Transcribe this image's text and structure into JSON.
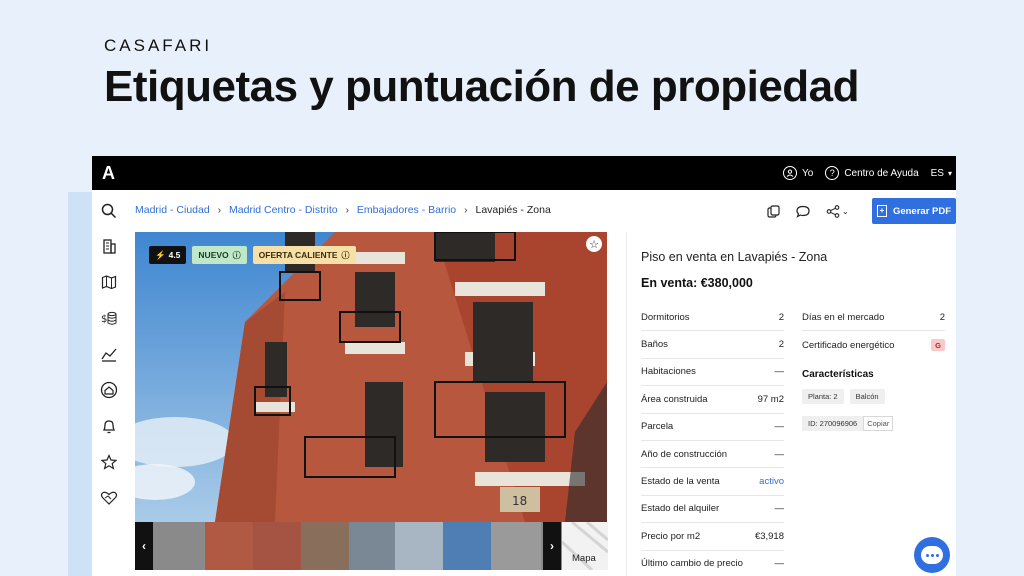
{
  "brand": "CASAFARI",
  "headline": "Etiquetas y puntuación de propiedad",
  "topbar": {
    "logo": "A",
    "user_label": "Yo",
    "help_label": "Centro de Ayuda",
    "language": "ES"
  },
  "breadcrumbs": [
    {
      "label": "Madrid - Ciudad"
    },
    {
      "label": "Madrid Centro - Distrito"
    },
    {
      "label": "Embajadores - Barrio"
    },
    {
      "label": "Lavapiés - Zona"
    }
  ],
  "toolbar": {
    "pdf_label": "Generar PDF"
  },
  "photo": {
    "score": "4.5",
    "new_tag": "NUEVO",
    "hot_tag": "OFERTA CALIENTE",
    "map_label": "Mapa",
    "door_number": "18"
  },
  "listing": {
    "title": "Piso en venta en Lavapiés - Zona",
    "price": "En venta: €380,000",
    "left_rows": [
      {
        "label": "Dormitorios",
        "value": "2"
      },
      {
        "label": "Baños",
        "value": "2"
      },
      {
        "label": "Habitaciones",
        "value": "—"
      },
      {
        "label": "Área construida",
        "value": "97 m2"
      },
      {
        "label": "Parcela",
        "value": "—"
      },
      {
        "label": "Año de construcción",
        "value": "—"
      },
      {
        "label": "Estado de la venta",
        "value": "activo"
      },
      {
        "label": "Estado del alquiler",
        "value": "—"
      },
      {
        "label": "Precio por m2",
        "value": "€3,918"
      },
      {
        "label": "Último cambio de precio",
        "value": "—"
      }
    ],
    "right_rows": [
      {
        "label": "Días en el mercado",
        "value": "2"
      },
      {
        "label": "Certificado energético",
        "value": "G"
      }
    ],
    "characteristics_title": "Características",
    "chips": [
      "Planta: 2",
      "Balcón"
    ],
    "id_label": "ID: 270096906",
    "copy_label": "Copiar"
  },
  "colors": {
    "accent": "#2f6fe0",
    "link": "#2f6fd6",
    "background": "#e8f0fb",
    "energy_g": "#f7c9c9"
  }
}
